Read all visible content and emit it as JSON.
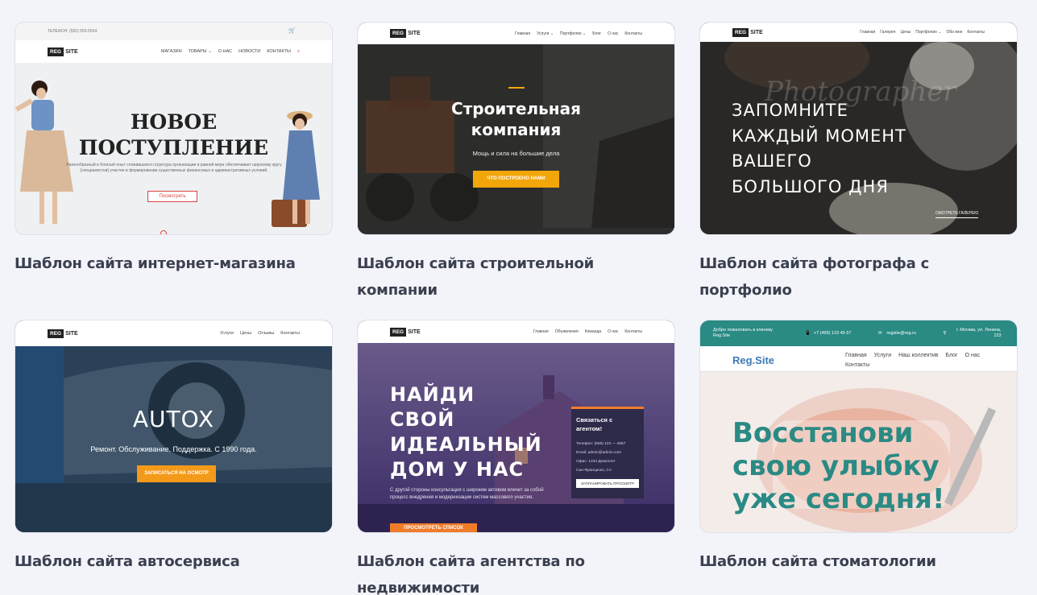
{
  "templates": [
    {
      "caption": "Шаблон сайта интернет-магазина",
      "topbar": "ТЕЛЕФОН: (555) 555-5554",
      "logo": "REG",
      "logo2": "SITE",
      "nav": [
        "МАГАЗИН",
        "ТОВАРЫ ⌄",
        "О НАС",
        "НОВОСТИ",
        "КОНТАКТЫ"
      ],
      "headline1": "НОВОЕ",
      "headline2": "ПОСТУПЛЕНИЕ",
      "body": "Разнообразный и богатый опыт сложившаяся структура организации в равной мере обеспечивает широкому кругу (специалистов) участие в формировании существенных финансовых и административных условий.",
      "button": "Посмотреть"
    },
    {
      "caption": "Шаблон сайта строительной компании",
      "logo": "REG",
      "logo2": "SITE",
      "nav": [
        "Главная",
        "Услуги ⌄",
        "Портфолио ⌄",
        "Блог",
        "О нас",
        "Контакты"
      ],
      "headline1": "Строительная",
      "headline2": "компания",
      "sub": "Мощь и сила на большие дела",
      "button": "что построено нами",
      "accent": "#f2a60a"
    },
    {
      "caption": "Шаблон сайта фотографа с портфолио",
      "logo": "REG",
      "logo2": "SITE",
      "nav": [
        "Главная",
        "Галерея",
        "Цены",
        "Портфолио ⌄",
        "Обо мне",
        "Контакты"
      ],
      "script": "Photographer",
      "lines": [
        "ЗАПОМНИТЕ",
        "КАЖДЫЙ МОМЕНТ",
        "ВАШЕГО",
        "БОЛЬШОГО ДНЯ"
      ],
      "link": "СМОТРЕТЬ ГАЛЕРЕЮ"
    },
    {
      "caption": "Шаблон сайта автосервиса",
      "logo": "REG",
      "logo2": "SITE",
      "nav": [
        "Услуги",
        "Цены",
        "Отзывы",
        "Контакты"
      ],
      "headline": "AUTOX",
      "sub": "Ремонт. Обслуживание. Поддержка. С 1990 года.",
      "button": "записаться на осмотр",
      "accent": "#f39a1a"
    },
    {
      "caption": "Шаблон сайта агентства по недвижимости",
      "logo": "REG",
      "logo2": "SITE",
      "nav": [
        "Главная",
        "Объявления",
        "Команда",
        "О нас",
        "Контакты"
      ],
      "lines": [
        "НАЙДИ",
        "СВОЙ",
        "ИДЕАЛЬНЫЙ",
        "ДОМ У НАС"
      ],
      "body": "С другой стороны консультация с широким активом влечет за собой процесс внедрения и модернизации систем массового участия.",
      "panel_title": "Связаться с агентом!",
      "panel_lines": [
        "Телефон: (555) 123 — 4567",
        "Email: admin@admin.com",
        "Офис: 1234 Девелопт",
        "Сан-Франциско, CA"
      ],
      "panel_button": "ЗАПЛАНИРОВАТЬ ПРОСМОТР",
      "button": "ПРОСМОТРЕТЬ СПИСОК",
      "accent": "#f07c2a"
    },
    {
      "caption": "Шаблон сайта стоматологии",
      "welcome": "Добро пожаловать в клинику Reg.Site",
      "phone": "+7 (495) 123 45 67",
      "email": "regsite@reg.ru",
      "address": "г. Москва, ул. Ленина, 123",
      "logo": "Reg.Site",
      "nav": [
        "Главная",
        "Услуги",
        "Наш коллектив",
        "Блог",
        "О нас",
        "Контакты"
      ],
      "lines": [
        "Восстанови",
        "свою улыбку",
        "уже сегодня!"
      ],
      "accent": "#2a8a84"
    }
  ]
}
